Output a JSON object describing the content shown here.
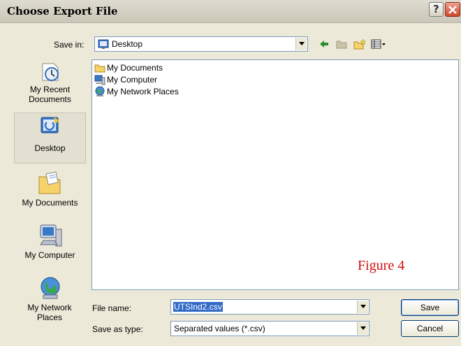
{
  "window": {
    "title": "Choose Export File"
  },
  "save_in": {
    "label": "Save in:",
    "value": "Desktop"
  },
  "places": [
    {
      "label": "My Recent Documents"
    },
    {
      "label": "Desktop"
    },
    {
      "label": "My Documents"
    },
    {
      "label": "My Computer"
    },
    {
      "label": "My Network Places"
    }
  ],
  "files": [
    {
      "name": "My Documents"
    },
    {
      "name": "My Computer"
    },
    {
      "name": "My Network Places"
    }
  ],
  "figure_label": "Figure 4",
  "file_name": {
    "label": "File name:",
    "value": "UTSInd2.csv"
  },
  "save_as_type": {
    "label": "Save as type:",
    "value": "Separated values (*.csv)"
  },
  "buttons": {
    "save": "Save",
    "cancel": "Cancel"
  },
  "colors": {
    "accent": "#d01010",
    "selection_border": "#7f9db9"
  }
}
